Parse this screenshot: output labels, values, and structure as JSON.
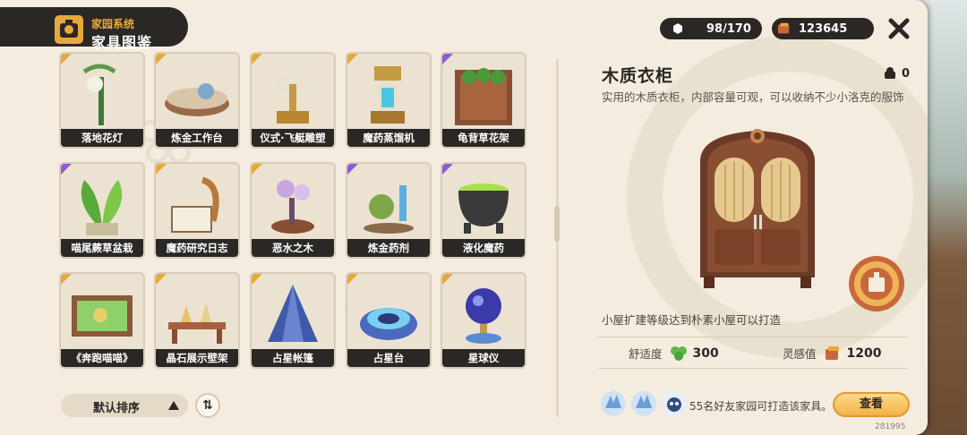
{
  "header": {
    "subtitle": "家园系统",
    "title": "家具图鉴"
  },
  "currency": {
    "capacity": "98/170",
    "coins": "123645"
  },
  "grid": {
    "items": [
      {
        "label": "落地花灯",
        "rarity": "orange",
        "icon": "flower-lamp-icon"
      },
      {
        "label": "炼金工作台",
        "rarity": "orange",
        "icon": "alchemy-bench-icon"
      },
      {
        "label": "仪式·飞艇雕塑",
        "rarity": "orange",
        "icon": "airship-statue-icon"
      },
      {
        "label": "魔药蒸馏机",
        "rarity": "orange",
        "icon": "distiller-icon"
      },
      {
        "label": "龟背草花架",
        "rarity": "purple",
        "icon": "plant-rack-icon"
      },
      {
        "label": "喵尾蕨草盆栽",
        "rarity": "purple",
        "icon": "potted-fern-icon"
      },
      {
        "label": "魔药研究日志",
        "rarity": "orange",
        "icon": "research-journal-icon"
      },
      {
        "label": "恶水之木",
        "rarity": "orange",
        "icon": "bonsai-tree-icon"
      },
      {
        "label": "炼金药剂",
        "rarity": "purple",
        "icon": "potion-bottles-icon"
      },
      {
        "label": "液化魔药",
        "rarity": "purple",
        "icon": "cauldron-icon"
      },
      {
        "label": "《奔跑喵喵》",
        "rarity": "orange",
        "icon": "painting-icon"
      },
      {
        "label": "晶石展示壁架",
        "rarity": "orange",
        "icon": "crystal-shelf-icon"
      },
      {
        "label": "占星帐篷",
        "rarity": "orange",
        "icon": "astro-tent-icon"
      },
      {
        "label": "占星台",
        "rarity": "orange",
        "icon": "astro-platform-icon"
      },
      {
        "label": "星球仪",
        "rarity": "orange",
        "icon": "orrery-icon"
      }
    ]
  },
  "sort": {
    "label": "默认排序",
    "toggle_glyph": "⇅"
  },
  "detail": {
    "title": "木质衣柜",
    "owned": "0",
    "description": "实用的木质衣柜，内部容量可观，可以收纳不少小洛克的服饰",
    "condition": "小屋扩建等级达到朴素小屋可以打造",
    "comfort_label": "舒适度",
    "comfort_value": "300",
    "inspiration_label": "灵感值",
    "inspiration_value": "1200",
    "friends_text": "55名好友家园可打造该家具。",
    "view_button": "查看"
  },
  "uid": "281995",
  "colors": {
    "dark": "#2b2724",
    "accent": "#e8a93c",
    "purple": "#8f5ad6",
    "panel": "#f3ecdf"
  }
}
